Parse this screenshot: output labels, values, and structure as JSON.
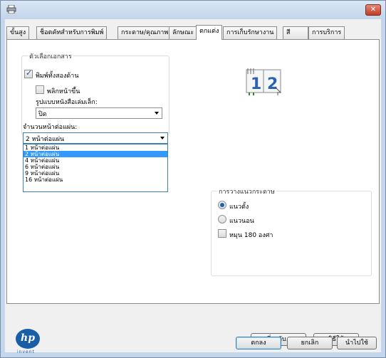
{
  "tabs": [
    {
      "id": "advanced",
      "label": "ขั้นสูง"
    },
    {
      "id": "shortcuts",
      "label": "ช็อตคัทสำหรับการพิมพ์"
    },
    {
      "id": "paper",
      "label": "กระดาษ/คุณภาพ"
    },
    {
      "id": "effects",
      "label": "ลักษณะ"
    },
    {
      "id": "finishing",
      "label": "ตกแต่ง"
    },
    {
      "id": "storage",
      "label": "การเก็บรักษางาน"
    },
    {
      "id": "color",
      "label": "สี"
    },
    {
      "id": "services",
      "label": "การบริการ"
    }
  ],
  "active_tab": "finishing",
  "document_options": {
    "title": "ตัวเลือกเอกสาร",
    "print_both_sides": {
      "label": "พิมพ์ทั้งสองด้าน",
      "checked": true
    },
    "flip_pages_up": {
      "label": "พลิกหน้าขึ้น",
      "checked": false
    },
    "booklet_layout": {
      "label": "รูปแบบหนังสือเล่มเล็ก:",
      "value": "ปิด"
    },
    "pages_per_sheet": {
      "label": "จำนวนหน้าต่อแผ่น:",
      "value": "2 หน้าต่อแผ่น",
      "options": [
        "1 หน้าต่อแผ่น",
        "2 หน้าต่อแผ่น",
        "4 หน้าต่อแผ่น",
        "6 หน้าต่อแผ่น",
        "9 หน้าต่อแผ่น",
        "16 หน้าต่อแผ่น"
      ],
      "selected_index": 1
    }
  },
  "preview": {
    "page1": "1",
    "page2": "2"
  },
  "orientation": {
    "title": "การวางแนวกระดาษ",
    "portrait": {
      "label": "แนวตั้ง",
      "selected": true
    },
    "landscape": {
      "label": "แนวนอน",
      "selected": false
    },
    "rotate_180": {
      "label": "หมุน 180 องศา",
      "checked": false
    }
  },
  "logo": {
    "text": "hp",
    "tagline": "invent"
  },
  "buttons": {
    "about": "เกี่ยวกับ...",
    "help": "วิธีใช้",
    "ok": "ตกลง",
    "cancel": "ยกเลิก",
    "apply": "นำไปใช้"
  },
  "colors": {
    "selection": "#3399ff",
    "window_frame": "#c3d6ec",
    "logo": "#1a5ea8"
  }
}
